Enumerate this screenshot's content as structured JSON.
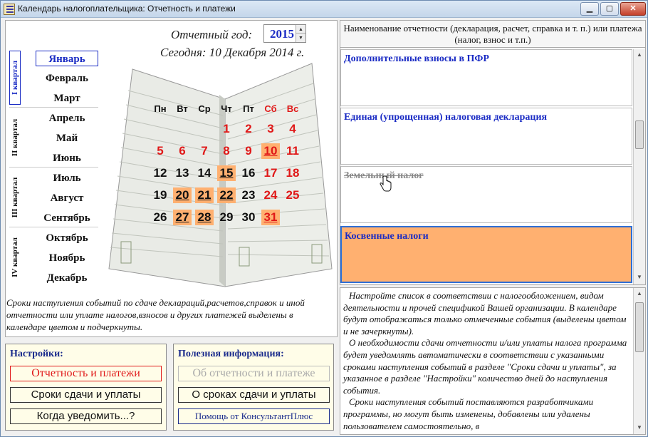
{
  "window": {
    "title": "Календарь налогоплательщика: Отчетность и платежи"
  },
  "header": {
    "year_label": "Отчетный год:",
    "year_value": "2015",
    "today_label": "Сегодня: 10 Декабря 2014 г."
  },
  "quarters": [
    {
      "label": "I квартал",
      "months": [
        "Январь",
        "Февраль",
        "Март"
      ]
    },
    {
      "label": "II квартал",
      "months": [
        "Апрель",
        "Май",
        "Июнь"
      ]
    },
    {
      "label": "III квартал",
      "months": [
        "Июль",
        "Август",
        "Сентябрь"
      ]
    },
    {
      "label": "IV квартал",
      "months": [
        "Октябрь",
        "Ноябрь",
        "Декабрь"
      ]
    }
  ],
  "selected_month": "Январь",
  "calendar": {
    "weekdays": [
      "Пн",
      "Вт",
      "Ср",
      "Чт",
      "Пт",
      "Сб",
      "Вс"
    ],
    "first_weekday_index": 3,
    "days_in_month": 31,
    "red_days": [
      1,
      2,
      3,
      4,
      5,
      6,
      7,
      8,
      9,
      10,
      11,
      17,
      18,
      24,
      25,
      31
    ],
    "highlighted_days": [
      10,
      15,
      20,
      21,
      22,
      27,
      28,
      31
    ]
  },
  "note_left": "Сроки наступления событий по сдаче деклараций,расчетов,справок и иной отчетности или уплате налогов,взносов и других платежей выделены в календаре цветом и подчеркнуты.",
  "settings": {
    "title": "Настройки:",
    "buttons": [
      "Отчетность и платежи",
      "Сроки сдачи и уплаты",
      "Когда уведомить...?"
    ]
  },
  "info": {
    "title": "Полезная информация:",
    "buttons": [
      "Об отчетности и платеже",
      "О сроках сдачи и уплаты",
      "Помощь от КонсультантПлюс"
    ]
  },
  "list": {
    "header": "Наименование отчетности (декларация, расчет, справка и т. п.) или платежа (налог, взнос и т.п.)",
    "items": [
      {
        "label": "Дополнительные взносы в ПФР",
        "state": "normal"
      },
      {
        "label": "Единая (упрощенная) налоговая декларация",
        "state": "normal"
      },
      {
        "label": "Земельный налог",
        "state": "struck"
      },
      {
        "label": "Косвенные налоги",
        "state": "selected"
      }
    ]
  },
  "help": {
    "paragraphs": [
      "Настройте список в соответствии с налогообложением, видом деятельности и прочей спецификой Вашей организации. В календаре будут отображаться только отмеченные события (выделены цветом и не зачеркнуты).",
      "О необходимости сдачи отчетности и/или уплаты налога программа будет уведомлять автоматически в соответствии с указанными сроками наступления событий в разделе \"Сроки сдачи и уплаты\", за указанное в разделе \"Настройки\" количество дней до наступления события.",
      "Сроки наступления событий поставляются разработчиками программы, но могут быть изменены, добавлены или удалены пользователем самостоятельно, в"
    ]
  },
  "colors": {
    "highlight": "#ffb070",
    "accent": "#1a2bc4",
    "weekend": "#e01818"
  },
  "icons": {
    "app": "calendar-app-icon",
    "cursor": "hand-pointer-icon"
  }
}
